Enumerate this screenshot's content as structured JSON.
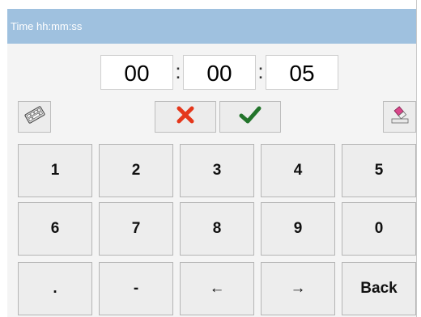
{
  "title": "Time hh:mm:ss",
  "time": {
    "hours": "00",
    "minutes": "00",
    "seconds": "05",
    "separator": ":"
  },
  "toolbar": {
    "keyboard_icon": "keyboard-icon",
    "cancel_icon": "red-x-icon",
    "confirm_icon": "green-checkmark-icon",
    "clear_icon": "eraser-icon",
    "cancel_color": "#e5371b",
    "confirm_color": "#23742b"
  },
  "keypad": {
    "row1": [
      "1",
      "2",
      "3",
      "4",
      "5"
    ],
    "row2": [
      "6",
      "7",
      "8",
      "9",
      "0"
    ],
    "row3": [
      ".",
      "-",
      "←",
      "→",
      "Back"
    ]
  }
}
